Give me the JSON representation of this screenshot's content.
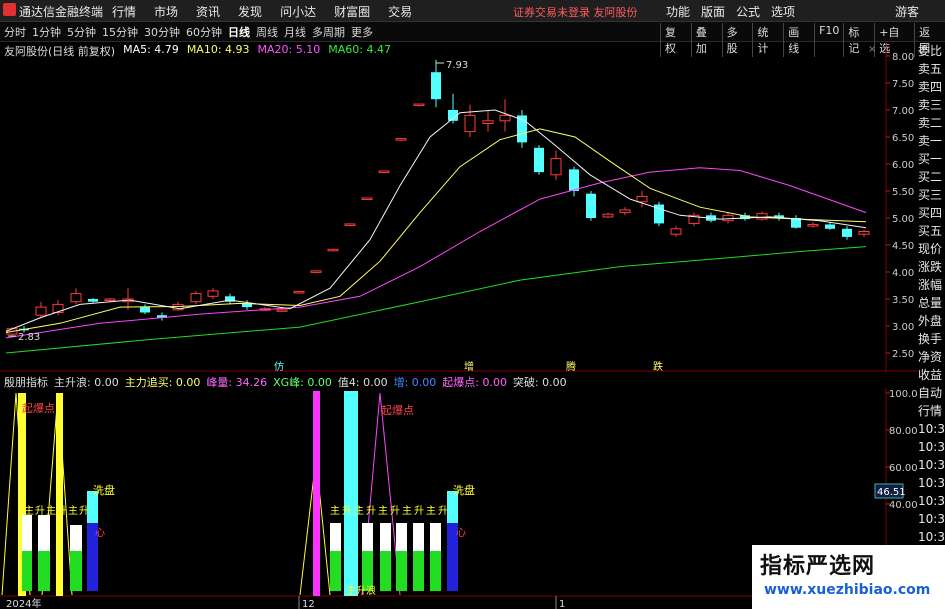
{
  "app": {
    "name": "通达信金融终端",
    "menu": [
      "行情",
      "市场",
      "资讯",
      "发现",
      "问小达",
      "财富圈",
      "交易"
    ],
    "notice": "证券交易未登录   友阿股份",
    "right_menu": [
      "功能",
      "版面",
      "公式",
      "选项"
    ],
    "guest": "游客"
  },
  "toolbar": {
    "periods": [
      "分时",
      "1分钟",
      "5分钟",
      "15分钟",
      "30分钟",
      "60分钟",
      "日线",
      "周线",
      "月线",
      "多周期",
      "更多"
    ],
    "active_period": "日线",
    "tools": [
      "复权",
      "叠加",
      "多股",
      "统计",
      "画线",
      "F10",
      "标记",
      "+自选",
      "返回"
    ]
  },
  "stock": {
    "title": "友阿股份(日线 前复权)",
    "ma5_label": "MA5: 4.79",
    "ma10_label": "MA10: 4.93",
    "ma20_label": "MA20: 5.10",
    "ma60_label": "MA60: 4.47",
    "high_label": "7.93",
    "low_label": "2.83",
    "annotations": [
      "仿",
      "增",
      "腾",
      "跌"
    ]
  },
  "colors": {
    "up": "#ff3b3b",
    "down": "#54ffff",
    "ma5": "#ffffff",
    "ma10": "#ffff66",
    "ma20": "#ff44ff",
    "ma60": "#22dd22"
  },
  "price_axis": [
    "8.00",
    "7.50",
    "7.00",
    "6.50",
    "6.00",
    "5.50",
    "5.00",
    "4.50",
    "4.00",
    "3.50",
    "3.00",
    "2.50"
  ],
  "indicator": {
    "name": "殷朋指标",
    "items": [
      {
        "text": "主升浪: 0.00",
        "color": "#dddddd"
      },
      {
        "text": "主力追买: 0.00",
        "color": "#ffff66"
      },
      {
        "text": "峰量: 34.26",
        "color": "#ff66ff"
      },
      {
        "text": "XG峰: 0.00",
        "color": "#66ff66"
      },
      {
        "text": "值4: 0.00",
        "color": "#dddddd"
      },
      {
        "text": "增: 0.00",
        "color": "#4488ff"
      },
      {
        "text": "起爆点: 0.00",
        "color": "#ff66ff"
      },
      {
        "text": "突破: 0.00",
        "color": "#dddddd"
      }
    ],
    "axis": [
      "100.00",
      "80.00",
      "60.00",
      "40.00"
    ],
    "current_value": "46.51",
    "labels": {
      "qibao1": "起爆点",
      "qibao2": "起爆点",
      "xipan1": "洗盘",
      "xipan2": "洗盘",
      "xin1": "心",
      "xin2": "心",
      "zhusheng": "主升浪"
    },
    "zhu_labels": [
      "主",
      "升",
      "主",
      "升",
      "主",
      "升"
    ],
    "zhu_labels_right": [
      "主",
      "升",
      "主",
      "升",
      "主",
      "升",
      "主",
      "升",
      "主",
      "升"
    ]
  },
  "date_axis": [
    "2024年",
    "12",
    "1"
  ],
  "side_panel": {
    "top": [
      "委比",
      "卖五",
      "卖四",
      "卖三",
      "卖二",
      "卖一",
      "买一",
      "买二",
      "买三",
      "买四",
      "买五",
      "现价",
      "涨跌",
      "涨幅",
      "总量",
      "外盘",
      "换手",
      "净资",
      "收益"
    ],
    "bottom": [
      "自动",
      "行情",
      "10:3",
      "10:3",
      "10:3",
      "10:3",
      "10:3",
      "10:3",
      "10:3",
      "10:3",
      "10:3"
    ]
  },
  "watermark": {
    "title": "指标严选网",
    "url": "www.xuezhibiao.com"
  }
}
